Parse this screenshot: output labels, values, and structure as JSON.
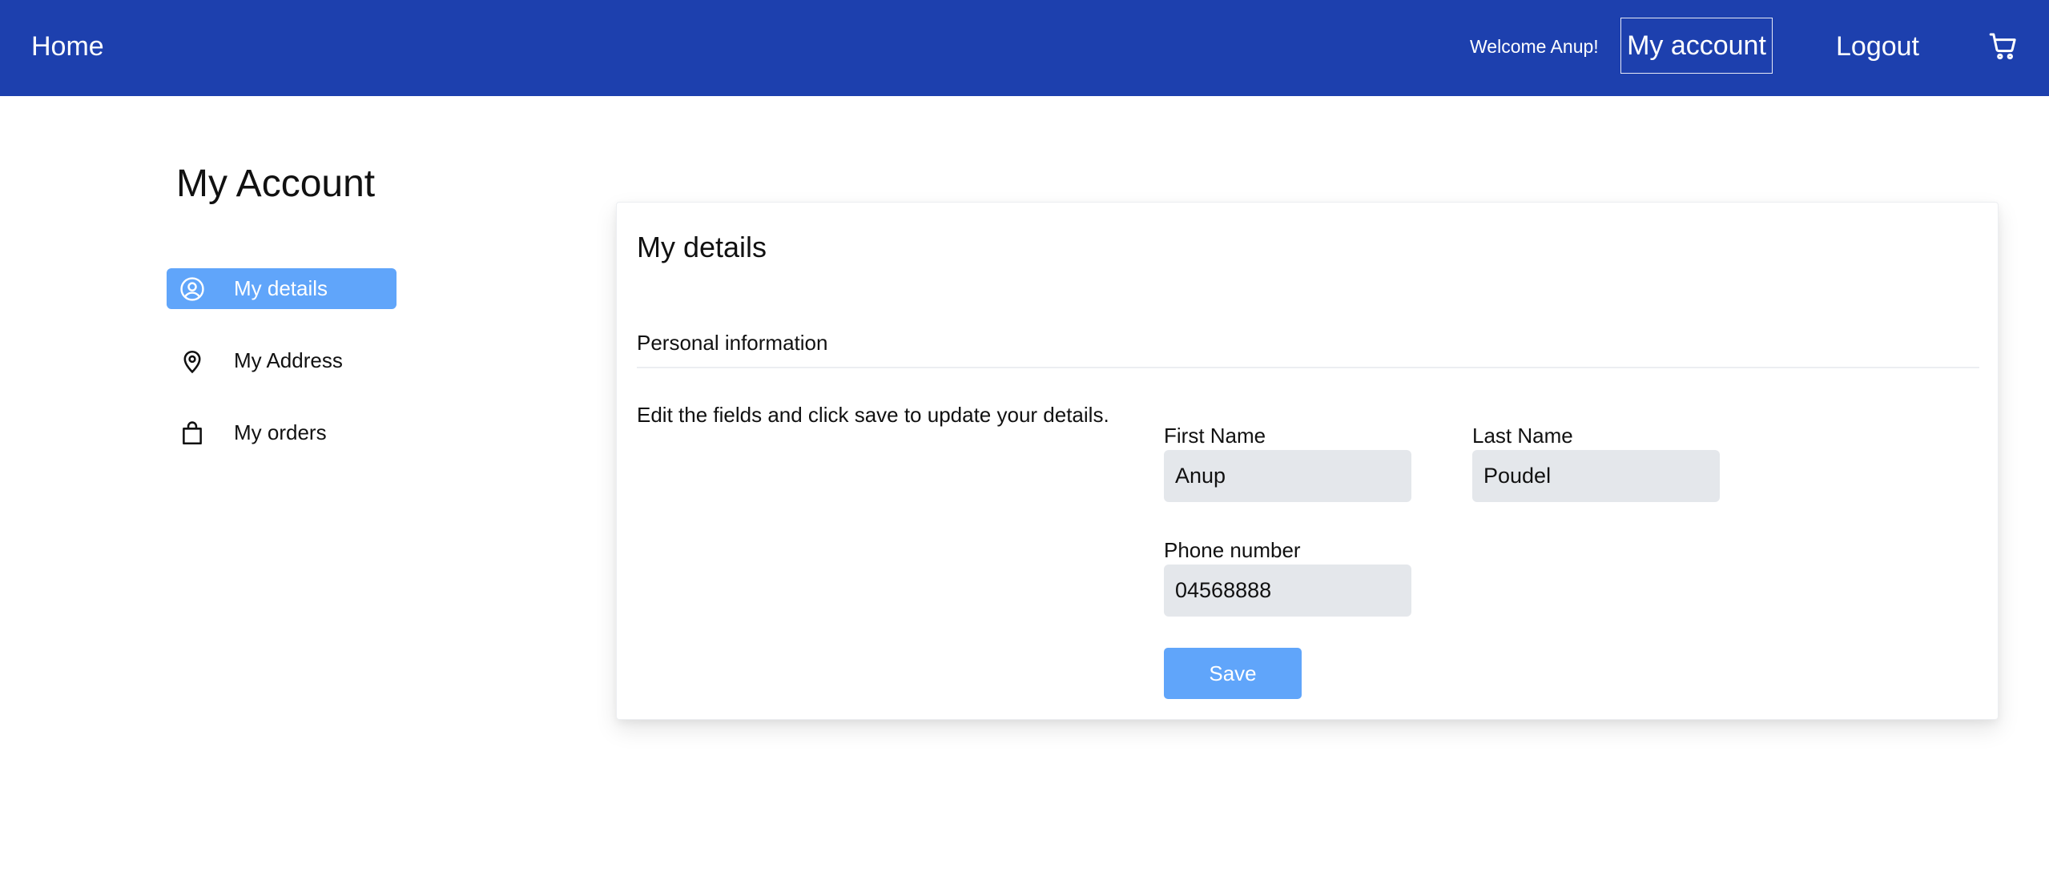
{
  "topbar": {
    "home_label": "Home",
    "welcome_text": "Welcome Anup!",
    "account_label": "My account",
    "logout_label": "Logout",
    "cart_icon": "cart-icon",
    "background": "#1d40ae"
  },
  "page": {
    "title": "My Account"
  },
  "sidebar": {
    "items": [
      {
        "label": "My details",
        "icon": "user-circle-icon",
        "active": true
      },
      {
        "label": "My Address",
        "icon": "map-pin-icon",
        "active": false
      },
      {
        "label": "My orders",
        "icon": "shopping-bag-icon",
        "active": false
      }
    ],
    "active_color": "#60a5fa"
  },
  "details": {
    "title": "My details",
    "section_label": "Personal information",
    "hint": "Edit the fields and click save to update your details.",
    "first_name": {
      "label": "First Name",
      "value": "Anup"
    },
    "last_name": {
      "label": "Last Name",
      "value": "Poudel"
    },
    "phone": {
      "label": "Phone number",
      "value": "04568888"
    },
    "save_label": "Save"
  }
}
